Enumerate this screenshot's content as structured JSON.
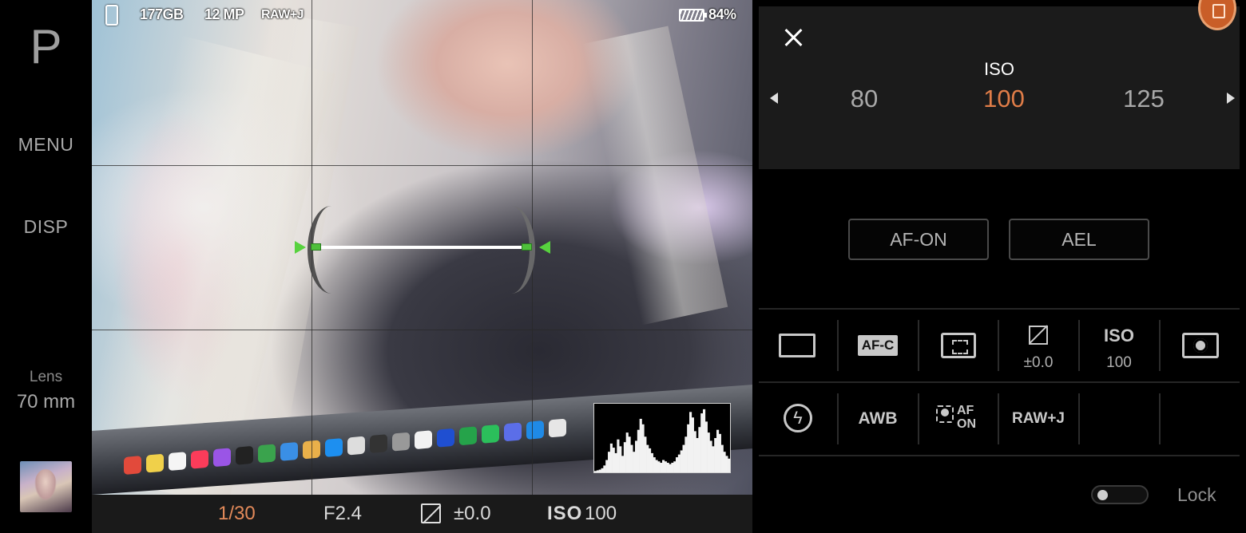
{
  "left_rail": {
    "mode": "P",
    "menu_label": "MENU",
    "disp_label": "DISP",
    "lens_label": "Lens",
    "lens_value": "70 mm"
  },
  "status_bar": {
    "storage": "177GB",
    "megapixels": "12 MP",
    "file_format": "RAW+J",
    "battery": "84%"
  },
  "exposure_bar": {
    "shutter": "1/30",
    "aperture": "F2.4",
    "ev_value": "±0.0",
    "iso_label": "ISO",
    "iso_value": "100"
  },
  "iso_panel": {
    "title": "ISO",
    "options": [
      "80",
      "100",
      "125"
    ],
    "selected": "100"
  },
  "buttons": {
    "af_on": "AF-ON",
    "ael": "AEL"
  },
  "function_row_1": {
    "focus_mode": "AF-C",
    "ev_value": "±0.0",
    "iso_label": "ISO",
    "iso_value": "100"
  },
  "function_row_2": {
    "white_balance": "AWB",
    "face_af": "AF ON",
    "file_format": "RAW+J"
  },
  "lock": {
    "label": "Lock"
  },
  "colors": {
    "accent": "#e07d48",
    "level_green": "#57d23e",
    "panel_bg": "#1b1b1b"
  },
  "histogram": {
    "bins": [
      2,
      3,
      4,
      6,
      10,
      18,
      30,
      42,
      36,
      28,
      48,
      38,
      24,
      44,
      58,
      52,
      40,
      30,
      46,
      62,
      78,
      70,
      52,
      40,
      35,
      28,
      22,
      18,
      16,
      14,
      18,
      16,
      14,
      12,
      14,
      16,
      22,
      26,
      32,
      40,
      52,
      70,
      88,
      80,
      60,
      50,
      66,
      86,
      92,
      74,
      58,
      46,
      38,
      50,
      62,
      56,
      40,
      30,
      24,
      20
    ]
  }
}
